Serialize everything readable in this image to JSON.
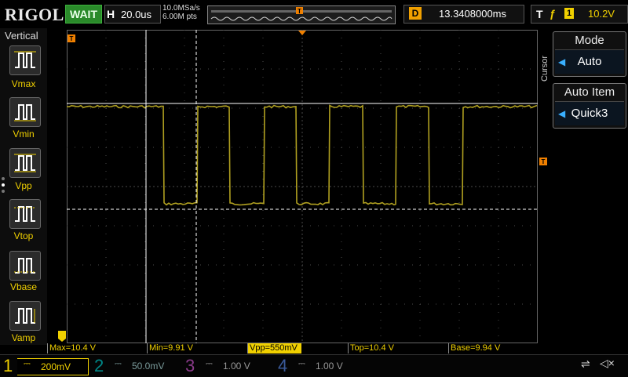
{
  "header": {
    "logo": "RIGOL",
    "run_status": "WAIT",
    "timebase_label": "H",
    "timebase_value": "20.0us",
    "sample_rate": "10.0MSa/s",
    "memory_depth": "6.00M pts",
    "delay_label": "D",
    "delay_value": "13.3408000ms",
    "trigger_label": "T",
    "trigger_channel": "1",
    "trigger_level": "10.2V"
  },
  "sidebar": {
    "title": "Vertical",
    "items": [
      {
        "label": "Vmax",
        "icon": "vmax-icon"
      },
      {
        "label": "Vmin",
        "icon": "vmin-icon"
      },
      {
        "label": "Vpp",
        "icon": "vpp-icon"
      },
      {
        "label": "Vtop",
        "icon": "vtop-icon"
      },
      {
        "label": "Vbase",
        "icon": "vbase-icon"
      },
      {
        "label": "Vamp",
        "icon": "vamp-icon"
      }
    ]
  },
  "right_menu": {
    "tab_label": "Cursor",
    "mode_title": "Mode",
    "mode_value": "Auto",
    "item_title": "Auto Item",
    "item_value": "Quick3"
  },
  "measurements": [
    {
      "label": "Max=10.4 V"
    },
    {
      "label": "Min=9.91 V"
    },
    {
      "label": "Vpp=550mV",
      "highlighted": true
    },
    {
      "label": "Top=10.4 V"
    },
    {
      "label": "Base=9.94 V"
    }
  ],
  "channels": [
    {
      "number": "1",
      "scale": "200mV",
      "color": "#f0d000",
      "active": true
    },
    {
      "number": "2",
      "scale": "50.0mV",
      "color": "#00c8c8",
      "active": false
    },
    {
      "number": "3",
      "scale": "1.00 V",
      "color": "#d040d0",
      "active": false
    },
    {
      "number": "4",
      "scale": "1.00 V",
      "color": "#3080ff",
      "active": false
    }
  ],
  "colors": {
    "ch1": "#f0d000",
    "trace": "#b0a020",
    "cursor": "#ffffff",
    "trigger_marker": "#f08000",
    "grid": "#4a4a4a"
  }
}
